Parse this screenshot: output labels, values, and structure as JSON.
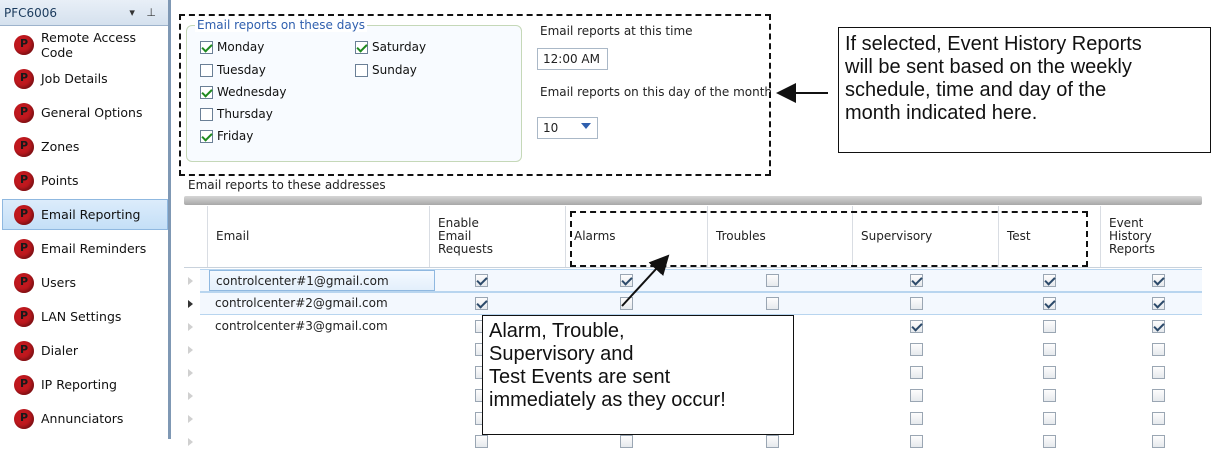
{
  "sidebar": {
    "title": "PFC6006",
    "pin_icons": "▾ ⊥",
    "items": [
      {
        "label": "Remote Access Code",
        "icon": "panel-logo-icon"
      },
      {
        "label": "Job Details",
        "icon": "panel-logo-icon"
      },
      {
        "label": "General Options",
        "icon": "panel-logo-icon"
      },
      {
        "label": "Zones",
        "icon": "panel-logo-icon"
      },
      {
        "label": "Points",
        "icon": "panel-logo-icon"
      },
      {
        "label": "Email Reporting",
        "icon": "panel-logo-icon",
        "active": true
      },
      {
        "label": "Email Reminders",
        "icon": "panel-logo-icon"
      },
      {
        "label": "Users",
        "icon": "panel-logo-icon"
      },
      {
        "label": "LAN Settings",
        "icon": "panel-logo-icon"
      },
      {
        "label": "Dialer",
        "icon": "panel-logo-icon"
      },
      {
        "label": "IP Reporting",
        "icon": "panel-logo-icon"
      },
      {
        "label": "Annunciators",
        "icon": "panel-logo-icon"
      }
    ]
  },
  "days": {
    "legend": "Email reports on these days",
    "monday": {
      "label": "Monday",
      "checked": true
    },
    "tuesday": {
      "label": "Tuesday",
      "checked": false
    },
    "wednesday": {
      "label": "Wednesday",
      "checked": true
    },
    "thursday": {
      "label": "Thursday",
      "checked": false
    },
    "friday": {
      "label": "Friday",
      "checked": true
    },
    "saturday": {
      "label": "Saturday",
      "checked": true
    },
    "sunday": {
      "label": "Sunday",
      "checked": false
    }
  },
  "time": {
    "label": "Email reports at this time",
    "value": "12:00 AM"
  },
  "day_of_month": {
    "label": "Email reports on this day of the month",
    "value": "10"
  },
  "addresses_label": "Email reports to these addresses",
  "grid": {
    "columns": {
      "email": "Email",
      "enable_l1": "Enable",
      "enable_l2": "Email",
      "enable_l3": "Requests",
      "alarms": "Alarms",
      "troubles": "Troubles",
      "supervisory": "Supervisory",
      "test": "Test",
      "ehr_l1": "Event",
      "ehr_l2": "History",
      "ehr_l3": "Reports"
    },
    "rows": [
      {
        "email": "controlcenter#1@gmail.com",
        "checks": [
          true,
          true,
          false,
          true,
          true,
          true
        ]
      },
      {
        "email": "controlcenter#2@gmail.com",
        "checks": [
          true,
          false,
          false,
          false,
          true,
          true
        ]
      },
      {
        "email": "controlcenter#3@gmail.com",
        "checks": [
          false,
          false,
          false,
          true,
          false,
          true
        ]
      },
      {
        "email": "",
        "checks": [
          false,
          false,
          false,
          false,
          false,
          false
        ]
      },
      {
        "email": "",
        "checks": [
          false,
          false,
          false,
          false,
          false,
          false
        ]
      },
      {
        "email": "",
        "checks": [
          false,
          false,
          false,
          false,
          false,
          false
        ]
      },
      {
        "email": "",
        "checks": [
          false,
          false,
          false,
          false,
          false,
          false
        ]
      },
      {
        "email": "",
        "checks": [
          false,
          false,
          false,
          false,
          false,
          false
        ]
      }
    ]
  },
  "callouts": {
    "top": [
      "If  selected, Event History Reports",
      "will be sent based on the weekly",
      "schedule, time and day of the",
      "month indicated here."
    ],
    "bottom": [
      "Alarm, Trouble,",
      "Supervisory and",
      "Test Events are sent",
      "immediately as they occur!"
    ]
  }
}
